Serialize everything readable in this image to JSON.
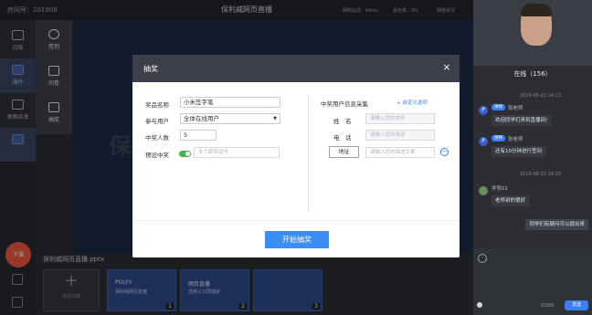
{
  "topbar": {
    "room": "房间号：201908",
    "title": "保利威网页直播",
    "stats": [
      "网络延迟：64ms",
      "丢包率：0%",
      "网络状况"
    ]
  },
  "leftnav": {
    "items": [
      {
        "label": "白板",
        "icon": "whiteboard-icon"
      },
      {
        "label": "课件",
        "icon": "courseware-icon"
      },
      {
        "label": "桌面共享",
        "icon": "screen-share-icon"
      },
      {
        "label": "",
        "icon": "camera-icon"
      }
    ],
    "fab_label": "下课"
  },
  "toolpanel": {
    "items": [
      {
        "label": "签到",
        "icon": "checkin-icon"
      },
      {
        "label": "问卷",
        "icon": "questionnaire-icon"
      },
      {
        "label": "抽奖",
        "icon": "lottery-icon"
      }
    ]
  },
  "stage": {
    "watermark": "保利"
  },
  "filebar": {
    "filename": "保利威网页直播.pptx",
    "add_label": "添加文档",
    "thumbs": [
      {
        "t1": "POLYV",
        "t2": "保利威网页直播",
        "num": "1"
      },
      {
        "t1": "网页直播",
        "t2": "支持三分屏播放",
        "num": "2"
      },
      {
        "t1": "",
        "t2": "",
        "num": "3"
      }
    ]
  },
  "rightcol": {
    "online": "在线（156）",
    "messages": [
      {
        "time": "2019-08-22 14:13"
      },
      {
        "badge": "讲师",
        "who": "张老师",
        "text": "欢迎同学们来到直播间!"
      },
      {
        "badge": "讲师",
        "who": "张老师",
        "text": "还有10分钟进行签到"
      },
      {
        "time": "2019-08-22 14:15"
      },
      {
        "who": "学员01",
        "text": "老师讲的很好"
      },
      {
        "text": "同学们有疑问可以提出来"
      }
    ],
    "counter": "0/200",
    "send": "发送"
  },
  "modal": {
    "title": "抽奖",
    "close": "×",
    "prize_label": "奖品名称",
    "prize_value": "小米签字笔",
    "participant_label": "参与用户",
    "participant_value": "全体在线用户",
    "count_label": "中奖人数",
    "count_value": "5",
    "preset_label": "预设中奖",
    "preset_placeholder": "多个昵称逗号",
    "winner_info_title": "中奖用户信息采集",
    "custom_option": "+ 自定义选项",
    "name_label": "姓　名",
    "name_placeholder": "请输入您的姓名",
    "phone_label": "电　话",
    "phone_placeholder": "请输入您的电话",
    "address_button": "地址",
    "address_placeholder": "请输入您的描述文案",
    "start_button": "开始抽奖"
  }
}
